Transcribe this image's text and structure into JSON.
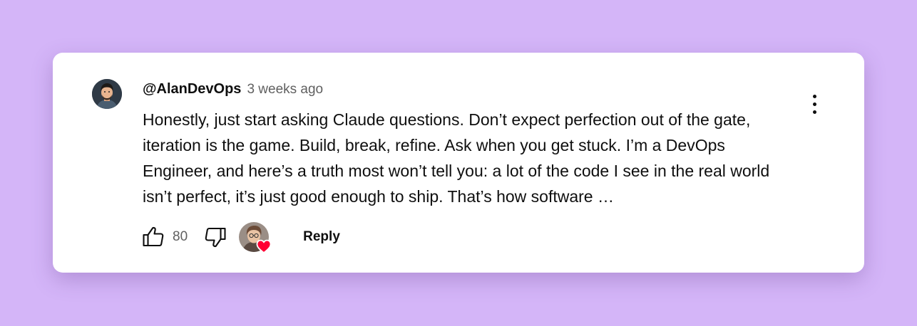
{
  "comment": {
    "author": "@AlanDevOps",
    "timestamp": "3 weeks ago",
    "text": "Honestly, just start asking Claude questions. Don’t expect perfection out of the gate, iteration is the game. Build, break, refine. Ask when you get stuck. I’m a DevOps Engineer, and here’s a truth most won’t tell you: a lot of the code I see in the real world isn’t perfect, it’s just good enough to ship. That’s how software …",
    "like_count": "80",
    "reply_label": "Reply"
  },
  "icons": {
    "like": "thumbs-up-icon",
    "dislike": "thumbs-down-icon",
    "menu": "more-vert-icon",
    "heart": "heart-icon"
  },
  "colors": {
    "background": "#d4b5f8",
    "card": "#ffffff",
    "text": "#0f0f0f",
    "muted": "#606060",
    "heart": "#ff0033"
  }
}
